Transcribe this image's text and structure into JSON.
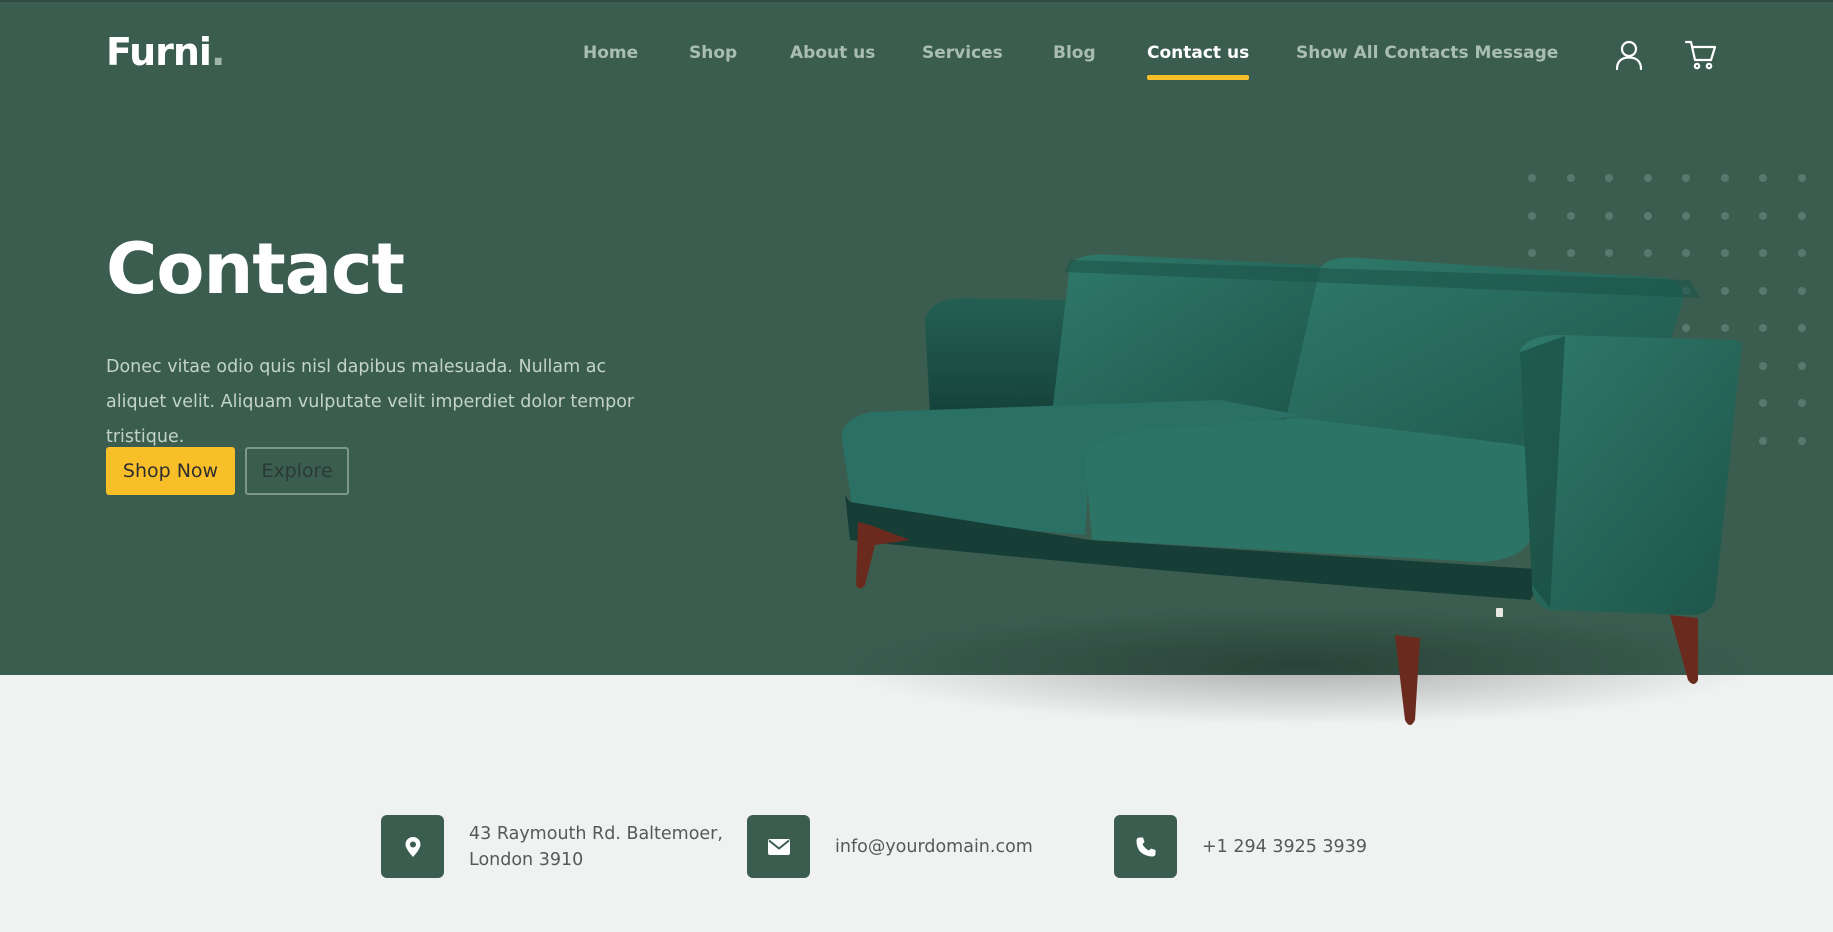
{
  "brand": {
    "name": "Furni",
    "dot": "."
  },
  "nav": {
    "items": [
      {
        "label": "Home"
      },
      {
        "label": "Shop"
      },
      {
        "label": "About us"
      },
      {
        "label": "Services"
      },
      {
        "label": "Blog"
      },
      {
        "label": "Contact us",
        "active": true
      },
      {
        "label": "Show All Contacts Message"
      }
    ]
  },
  "header_icons": [
    "user-icon",
    "cart-icon"
  ],
  "hero": {
    "title": "Contact",
    "text": "Donec vitae odio quis nisl dapibus malesuada. Nullam ac aliquet velit. Aliquam vulputate velit imperdiet dolor tempor tristique.",
    "primary_button": "Shop Now",
    "secondary_button": "Explore"
  },
  "contact": {
    "address_line1": "43 Raymouth Rd. Baltemoer,",
    "address_line2": "London 3910",
    "email": "info@yourdomain.com",
    "phone": "+1 294 3925 3939"
  },
  "colors": {
    "primary": "#3b5d50",
    "accent": "#f9bf29",
    "background": "#eff2f1",
    "sofa": "#2b6a5e"
  }
}
